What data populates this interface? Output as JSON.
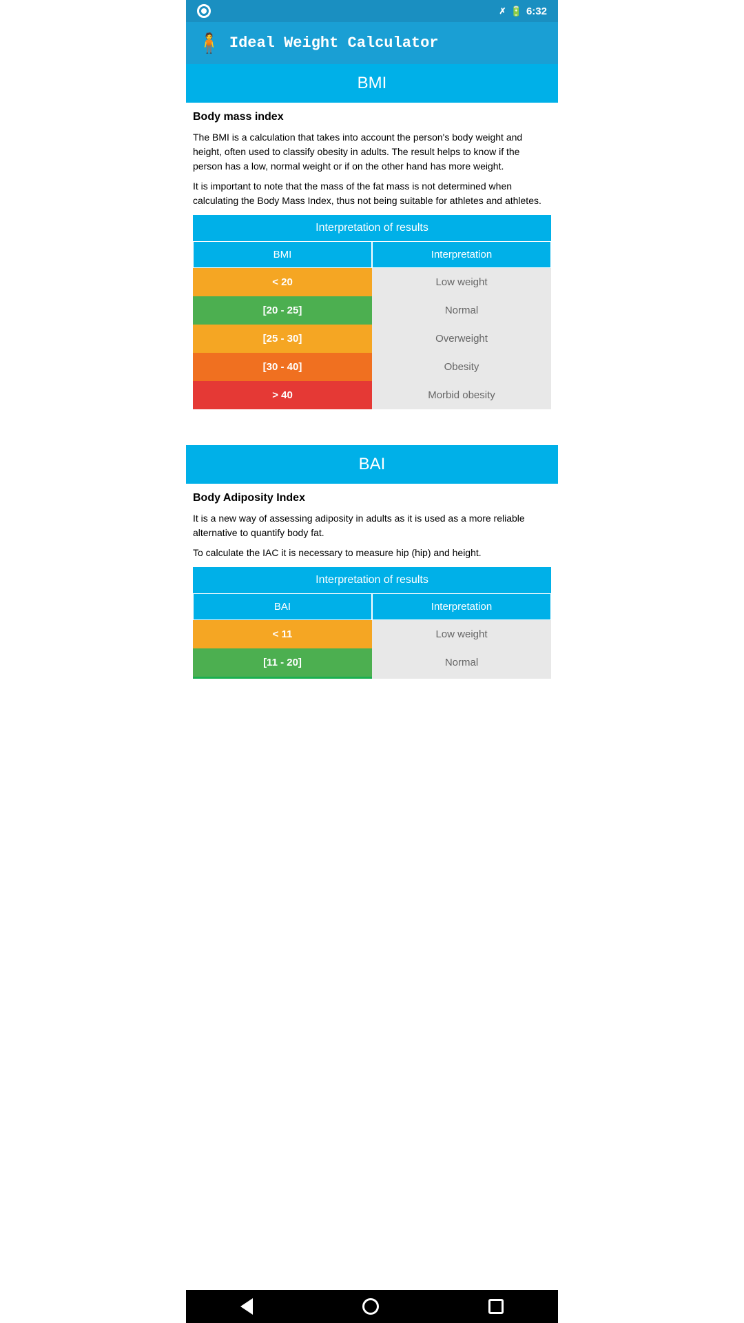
{
  "statusBar": {
    "time": "6:32"
  },
  "header": {
    "icon": "⊙",
    "title": "Ideal Weight Calculator"
  },
  "bmi": {
    "sectionLabel": "BMI",
    "titleLabel": "Body mass index",
    "description1": "The BMI is a calculation that takes into account the person's body weight and height, often used to classify obesity in adults. The result helps to know if the person has a low, normal weight or if on the other hand has more weight.",
    "description2": "It is important to note that the mass of the fat mass is not determined when calculating the Body Mass Index, thus not being suitable for athletes and athletes.",
    "tableHeader": "Interpretation of results",
    "colBMI": "BMI",
    "colInterp": "Interpretation",
    "rows": [
      {
        "range": "< 20",
        "color": "bmi-orange",
        "interp": "Low weight"
      },
      {
        "range": "[20 - 25]",
        "color": "bmi-green",
        "interp": "Normal"
      },
      {
        "range": "[25 - 30]",
        "color": "bmi-orange2",
        "interp": "Overweight"
      },
      {
        "range": "[30 - 40]",
        "color": "bmi-orange-red",
        "interp": "Obesity"
      },
      {
        "range": "> 40",
        "color": "bmi-red",
        "interp": "Morbid obesity"
      }
    ]
  },
  "bai": {
    "sectionLabel": "BAI",
    "titleLabel": "Body Adiposity Index",
    "description1": "It is a new way of assessing adiposity in adults as it is used as a more reliable alternative to quantify body fat.",
    "description2": "To calculate the IAC it is necessary to measure hip (hip) and height.",
    "tableHeader": "Interpretation of results",
    "colBAI": "BAI",
    "colInterp": "Interpretation",
    "rows": [
      {
        "range": "< 11",
        "color": "bmi-orange",
        "interp": "Low weight"
      },
      {
        "range": "[11 - 20]",
        "color": "bmi-green",
        "interp": "Normal"
      }
    ]
  },
  "nav": {
    "back": "◀",
    "home": "●",
    "recents": "■"
  }
}
